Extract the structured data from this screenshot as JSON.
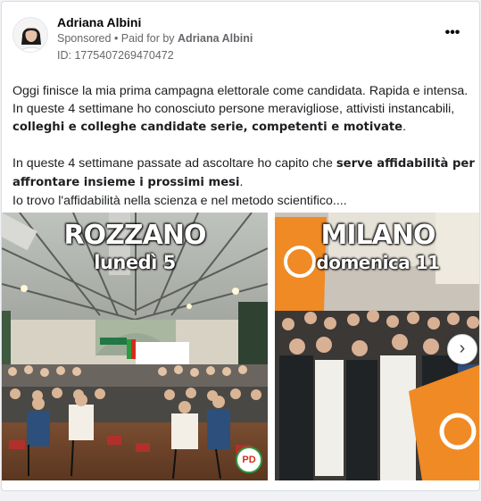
{
  "advertiser": {
    "name": "Adriana Albini",
    "sponsored_label": "Sponsored",
    "separator": " • ",
    "paid_for_prefix": "Paid for by ",
    "paid_for_by": "Adriana Albini",
    "ad_id": "ID: 1775407269470472"
  },
  "post": {
    "line1": "Oggi finisce la mia prima campagna elettorale come candidata. Rapida e intensa.",
    "line2": "In queste 4 settimane ho conosciuto persone meravigliose, attivisti instancabili,",
    "line3_bold": "colleghi e colleghe candidate serie, competenti e motivate",
    "line3_end": ".",
    "line4_start": "In queste 4 settimane passate ad ascoltare ho capito che ",
    "line4_bold": "serve affidabilità per",
    "line5_bold": "affrontare insieme i prossimi mesi",
    "line5_end": ".",
    "line6": "Io trovo l'affidabilità nella scienza e nel metodo scientifico...."
  },
  "carousel": {
    "slides": [
      {
        "title": "ROZZANO",
        "subtitle": "lunedì 5",
        "logo_text": "PD"
      },
      {
        "title": "MILANO",
        "subtitle": "domenica 11"
      }
    ],
    "next_glyph": "›"
  },
  "icons": {
    "more": "more-options-icon",
    "next": "chevron-right-icon"
  },
  "colors": {
    "link_gray": "#65676b",
    "flag_orange": "#f08a24",
    "pd_red": "#d52b1e",
    "pd_green": "#2e9a3e"
  }
}
